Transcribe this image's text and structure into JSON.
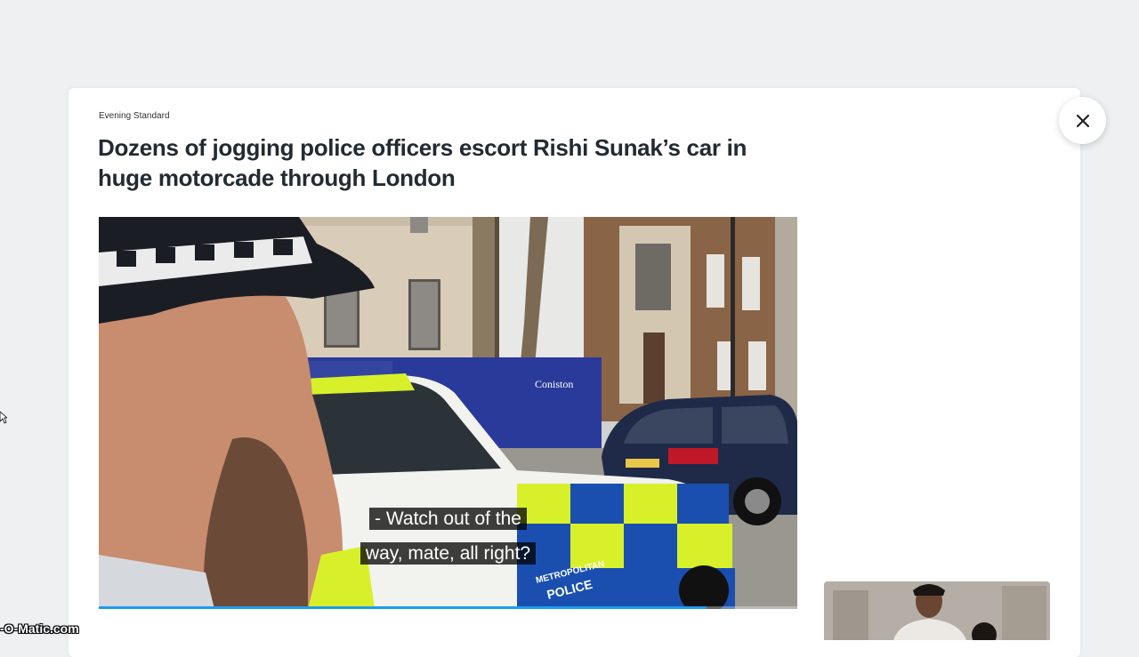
{
  "article": {
    "source": "Evening Standard",
    "headline": "Dozens of jogging police officers escort Rishi Sunak’s car in huge motorcade through London"
  },
  "video": {
    "caption_line1": "- Watch out of the",
    "caption_line2": "way, mate, all right?",
    "progress": 0.87,
    "signage": {
      "hoarding_brand": "Coniston",
      "car_livery_1": "METROPOLITAN",
      "car_livery_2": "POLICE"
    }
  },
  "icons": {
    "close": "close-icon",
    "cursor": "mouse-cursor-icon"
  },
  "watermark": {
    "text": "-O-Matic.com"
  },
  "colors": {
    "page_bg": "#eef0f2",
    "headline": "#232a31",
    "progress": "#1d9bf0",
    "police_yellow": "#d8f02a",
    "police_blue": "#1a4fb0"
  }
}
